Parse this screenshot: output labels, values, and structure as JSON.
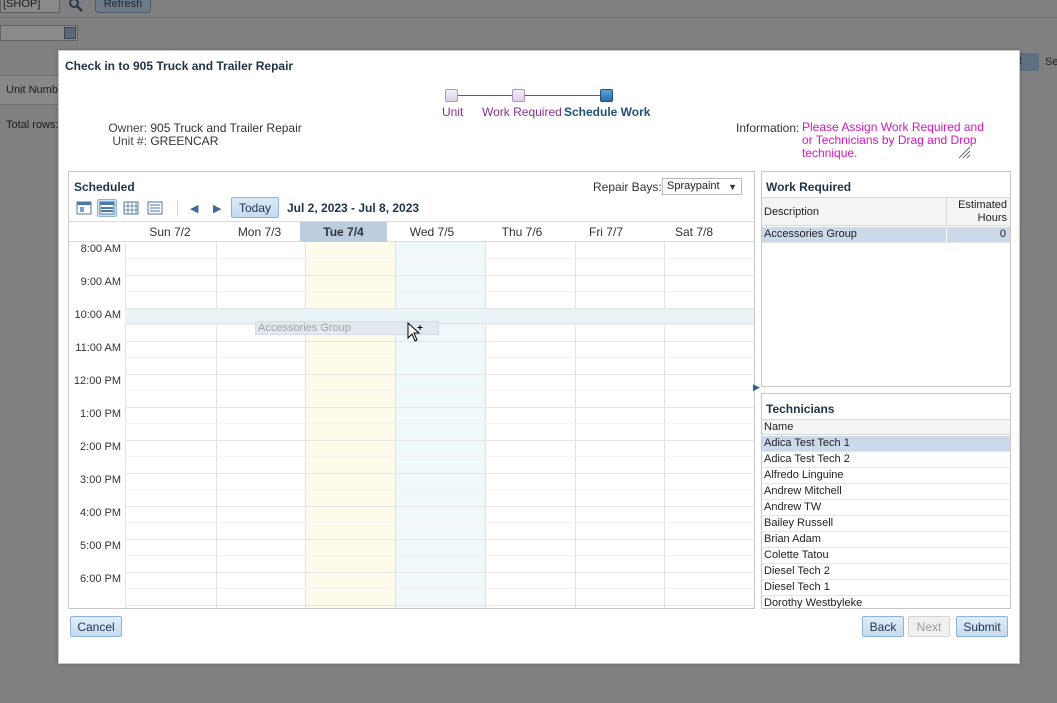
{
  "background": {
    "shop_value": "[SHOP]",
    "refresh_label": "Refresh",
    "unit_header": "Unit Number",
    "total_rows": "Total rows:",
    "right_btn": "t",
    "right_text": "Se"
  },
  "dialog": {
    "title": "Check in to 905 Truck and Trailer Repair"
  },
  "train": {
    "steps": [
      {
        "label": "Unit"
      },
      {
        "label": "Work Required"
      },
      {
        "label": "Schedule Work"
      }
    ]
  },
  "info": {
    "owner_label": "Owner:",
    "owner_value": "905 Truck and Trailer Repair",
    "unit_label": "Unit #:",
    "unit_value": "GREENCAR",
    "information_label": "Information:",
    "information_line1": "Please Assign Work Required and",
    "information_line2": "or Technicians by Drag and Drop",
    "information_line3": "technique."
  },
  "scheduled": {
    "title": "Scheduled",
    "bays_label": "Repair Bays:",
    "bays_value": "Spraypaint",
    "today_label": "Today",
    "date_range": "Jul 2, 2023 - Jul 8, 2023",
    "days": [
      "Sun 7/2",
      "Mon 7/3",
      "Tue 7/4",
      "Wed 7/5",
      "Thu 7/6",
      "Fri 7/7",
      "Sat 7/8"
    ],
    "today_day": "Tue 7/4",
    "times": [
      "8:00 AM",
      "9:00 AM",
      "10:00 AM",
      "11:00 AM",
      "12:00 PM",
      "1:00 PM",
      "2:00 PM",
      "3:00 PM",
      "4:00 PM",
      "5:00 PM",
      "6:00 PM"
    ],
    "drag_item": "Accessories Group"
  },
  "work_required": {
    "title": "Work Required",
    "col_description": "Description",
    "col_hours_line1": "Estimated",
    "col_hours_line2": "Hours",
    "rows": [
      {
        "description": "Accessories Group",
        "hours": "0"
      }
    ]
  },
  "technicians": {
    "title": "Technicians",
    "col_name": "Name",
    "rows": [
      "Adica Test Tech 1",
      "Adica Test Tech 2",
      "Alfredo Linguine",
      "Andrew Mitchell",
      "Andrew TW",
      "Bailey Russell",
      "Brian Adam",
      "Colette Tatou",
      "Diesel Tech 2",
      "Diesel Tech 1",
      "Dorothy Westbyleke"
    ]
  },
  "buttons": {
    "cancel": "Cancel",
    "back": "Back",
    "next": "Next",
    "submit": "Submit"
  },
  "colors": {
    "accent": "#1f3349",
    "train": "#8a2f8f",
    "info_text": "#d516c2",
    "today_column": "#fdfbe9",
    "selection": "#cbd9ea"
  }
}
